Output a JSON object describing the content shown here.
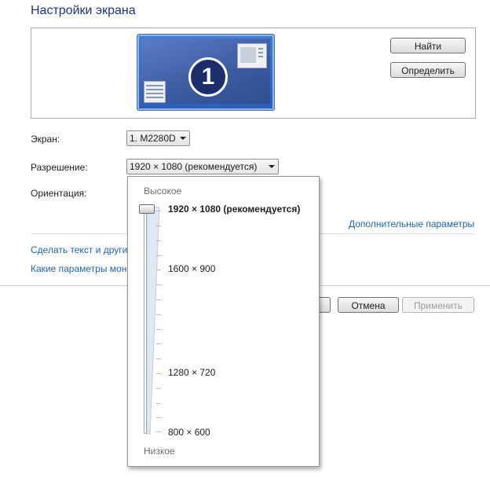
{
  "title": "Настройки экрана",
  "preview": {
    "monitor_number": "1",
    "find_button": "Найти",
    "identify_button": "Определить"
  },
  "form": {
    "screen_label": "Экран:",
    "screen_value": "1. M2280D",
    "resolution_label": "Разрешение:",
    "resolution_value": "1920 × 1080 (рекомендуется)",
    "orientation_label": "Ориентация:"
  },
  "links": {
    "advanced": "Дополнительные параметры",
    "text_size": "Сделать текст и другие",
    "which_params": "Какие параметры мон"
  },
  "buttons": {
    "cancel": "Отмена",
    "apply": "Применить"
  },
  "resolution_popup": {
    "high_label": "Высокое",
    "low_label": "Низкое",
    "selected_fraction": 1.0,
    "options": [
      {
        "label": "1920 × 1080 (рекомендуется)"
      },
      {
        "label": "1600 × 900"
      },
      {
        "label": "1280 × 720"
      },
      {
        "label": "800 × 600"
      }
    ]
  },
  "colors": {
    "title": "#1e3287",
    "link": "#1f64b4",
    "monitor_blue": "#2a5fb8"
  }
}
